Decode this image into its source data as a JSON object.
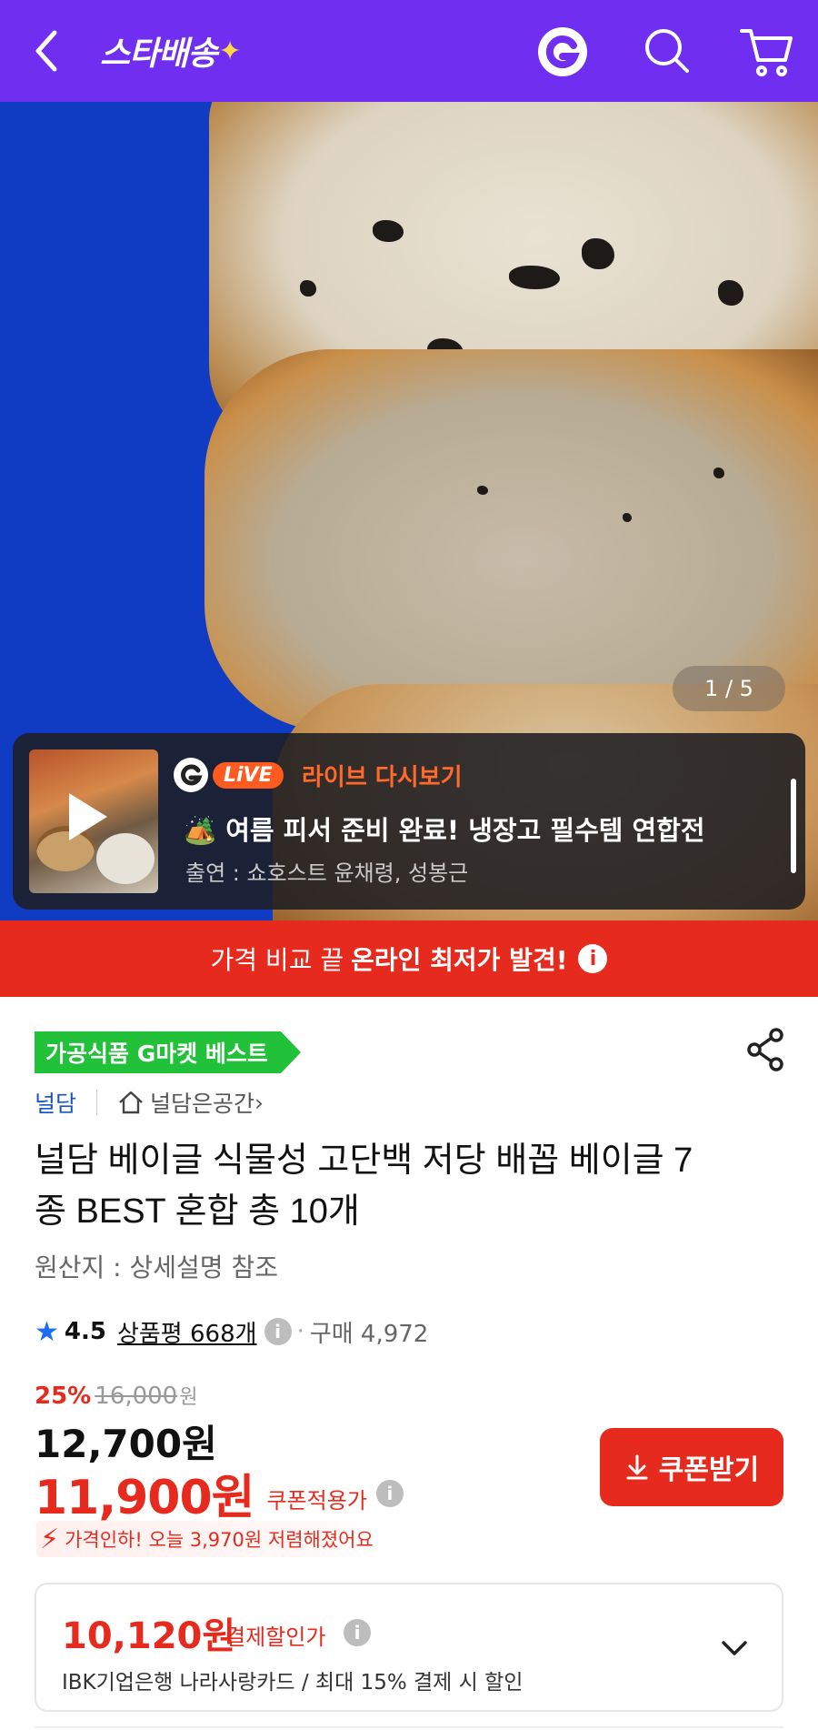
{
  "header": {
    "logo_text": "스타배송",
    "logo_star": "✦",
    "accent": "#6f2ef0"
  },
  "hero": {
    "counter": "1 / 5"
  },
  "live": {
    "pill": "LiVE",
    "tag": "라이브 다시보기",
    "title": "🏕️ 여름 피서 준비 완료! 냉장고 필수템 연합전",
    "cast": "출연 : 쇼호스트 윤채령, 성봉근"
  },
  "banner": {
    "text_prefix": "가격 비교 끝",
    "text_bold": "온라인 최저가 발견!",
    "info": "i",
    "color": "#e62b1e"
  },
  "product": {
    "badge": "가공식품 G마켓 베스트",
    "brand": "널담",
    "store": "널담은공간",
    "store_chevron": "›",
    "title": "널담 베이글 식물성 고단백 저당 배꼽 베이글 7종 BEST 혼합 총 10개",
    "origin": "원산지 : 상세설명 참조",
    "rating": "4.5",
    "reviews": "상품평 668개",
    "dot": "·",
    "purchases": "구매 4,972"
  },
  "price": {
    "discount": "25%",
    "original": "16,000",
    "won": "원",
    "sale": "12,700원",
    "coupon_price": "11,900원",
    "coupon_label": "쿠폰적용가",
    "coupon_button": "쿠폰받기",
    "drop_note": "가격인하! 오늘 3,970원 저렴해졌어요"
  },
  "payment": {
    "price": "10,120원",
    "label": "결제할인가",
    "desc": "IBK기업은행 나라사랑카드 / 최대 15% 결제 시 할인"
  }
}
